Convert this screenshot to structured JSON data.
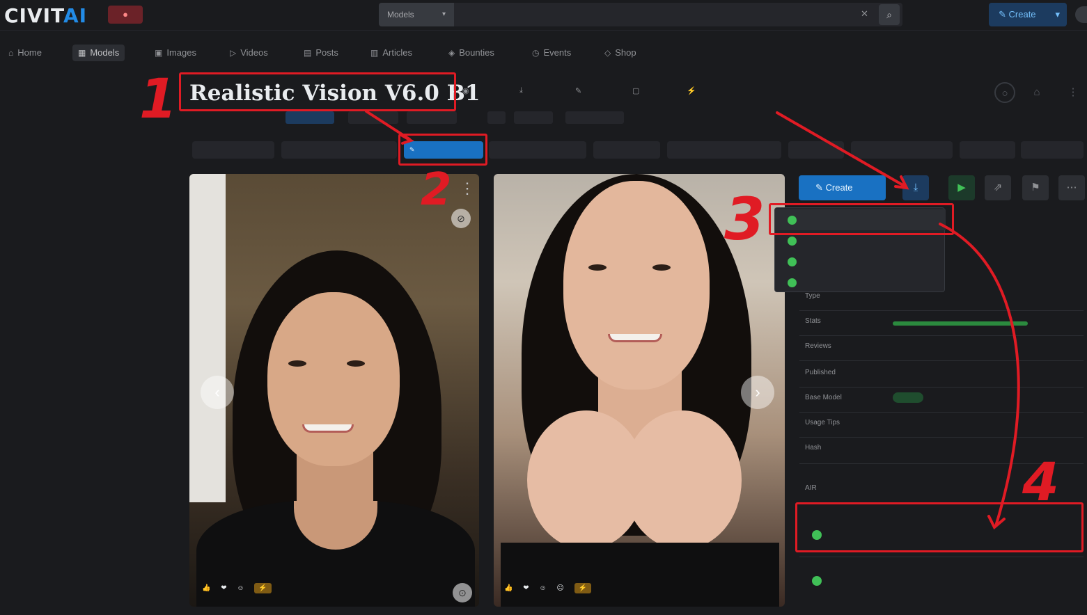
{
  "header": {
    "logo_main": "CIVIT",
    "logo_ai": "AI",
    "live_badge": "",
    "search_type": "Models",
    "search_placeholder": "",
    "create_label": "Create"
  },
  "nav": {
    "items": [
      {
        "label": "Home",
        "icon": "home-icon"
      },
      {
        "label": "Models",
        "icon": "models-icon",
        "active": true
      },
      {
        "label": "Images",
        "icon": "images-icon"
      },
      {
        "label": "Videos",
        "icon": "videos-icon"
      },
      {
        "label": "Posts",
        "icon": "posts-icon"
      },
      {
        "label": "Articles",
        "icon": "articles-icon"
      },
      {
        "label": "Bounties",
        "icon": "bounties-icon"
      },
      {
        "label": "Events",
        "icon": "events-icon"
      },
      {
        "label": "Shop",
        "icon": "shop-icon"
      }
    ]
  },
  "model": {
    "title": "Realistic Vision V6.0 B1"
  },
  "sidebar_panel": {
    "create_label": "Create",
    "details_labels": [
      "Type",
      "Stats",
      "Reviews",
      "Published",
      "Base Model",
      "Usage Tips",
      "Hash",
      "AIR"
    ]
  },
  "annotations": {
    "n1": "1",
    "n2": "2",
    "n3": "3",
    "n4": "4"
  },
  "colors": {
    "accent": "#1971c2",
    "annotation": "#e01b24",
    "background": "#1a1b1e"
  }
}
